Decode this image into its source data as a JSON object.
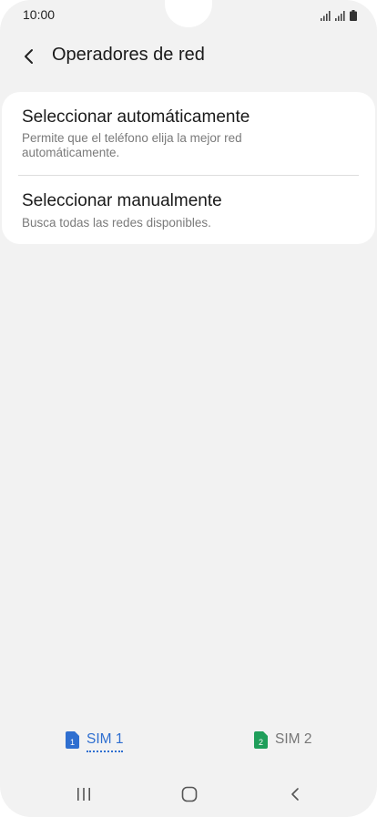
{
  "status_bar": {
    "time": "10:00",
    "icons": [
      "signal-sim1-icon",
      "signal-sim2-icon",
      "battery-icon"
    ]
  },
  "header": {
    "back_icon": "chevron-left-icon",
    "title": "Operadores de red"
  },
  "options": [
    {
      "title": "Seleccionar automáticamente",
      "description": "Permite que el teléfono elija la mejor red automáticamente."
    },
    {
      "title": "Seleccionar manualmente",
      "description": "Busca todas las redes disponibles."
    }
  ],
  "sim_tabs": [
    {
      "label": "SIM 1",
      "badge": "1",
      "color": "#2f6fd0",
      "selected": true
    },
    {
      "label": "SIM 2",
      "badge": "2",
      "color": "#1f9e5a",
      "selected": false
    }
  ],
  "nav_bar": {
    "icons": [
      "recents-icon",
      "home-icon",
      "back-icon"
    ]
  },
  "colors": {
    "background": "#f2f2f2",
    "card": "#ffffff",
    "accent": "#2f6fd0"
  }
}
